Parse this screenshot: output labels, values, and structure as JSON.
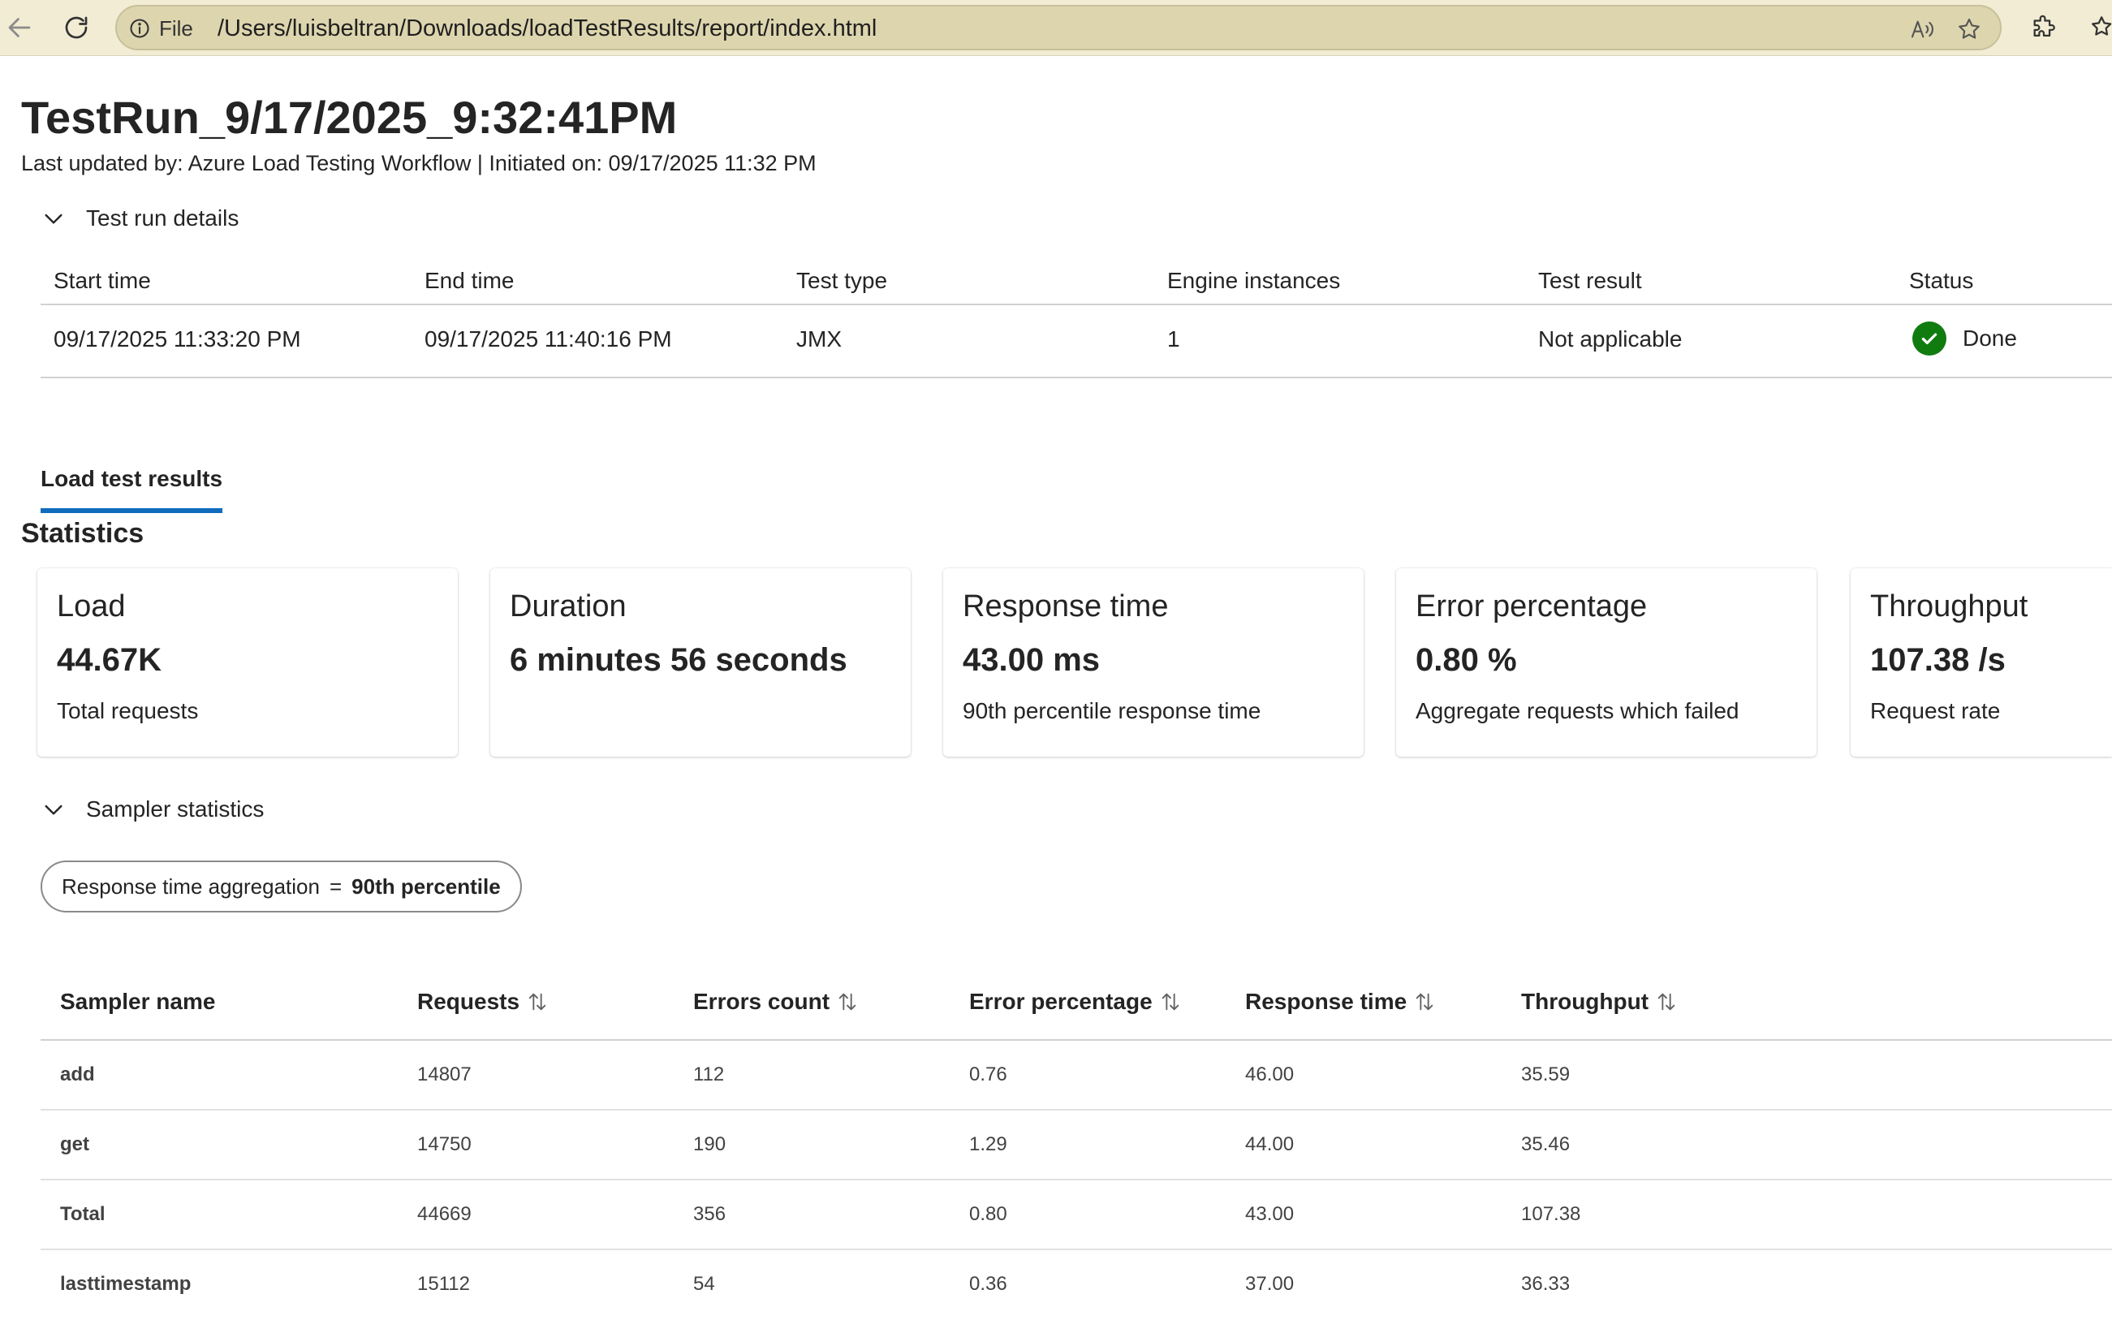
{
  "browser": {
    "file_label": "File",
    "url": "/Users/luisbeltran/Downloads/loadTestResults/report/index.html"
  },
  "page": {
    "title": "TestRun_9/17/2025_9:32:41PM",
    "subtitle": "Last updated by: Azure Load Testing Workflow | Initiated on: 09/17/2025 11:32 PM"
  },
  "details": {
    "section_label": "Test run details",
    "headers": [
      "Start time",
      "End time",
      "Test type",
      "Engine instances",
      "Test result",
      "Status"
    ],
    "row": [
      "09/17/2025 11:33:20 PM",
      "09/17/2025 11:40:16 PM",
      "JMX",
      "1",
      "Not applicable",
      "Done"
    ],
    "status_color": "#107c10"
  },
  "tabs": {
    "active": "Load test results",
    "accent": "#0f6cbd"
  },
  "statistics": {
    "heading": "Statistics",
    "cards": [
      {
        "title": "Load",
        "value": "44.67K",
        "desc": "Total requests"
      },
      {
        "title": "Duration",
        "value": "6 minutes 56 seconds",
        "desc": ""
      },
      {
        "title": "Response time",
        "value": "43.00 ms",
        "desc": "90th percentile response time"
      },
      {
        "title": "Error percentage",
        "value": "0.80 %",
        "desc": "Aggregate requests which failed"
      },
      {
        "title": "Throughput",
        "value": "107.38 /s",
        "desc": "Request rate"
      }
    ]
  },
  "sampler": {
    "section_label": "Sampler statistics",
    "filter_label": "Response time aggregation",
    "filter_eq": "=",
    "filter_value": "90th percentile",
    "headers": [
      "Sampler name",
      "Requests",
      "Errors count",
      "Error percentage",
      "Response time",
      "Throughput"
    ],
    "rows": [
      [
        "add",
        "14807",
        "112",
        "0.76",
        "46.00",
        "35.59"
      ],
      [
        "get",
        "14750",
        "190",
        "1.29",
        "44.00",
        "35.46"
      ],
      [
        "Total",
        "44669",
        "356",
        "0.80",
        "43.00",
        "107.38"
      ],
      [
        "lasttimestamp",
        "15112",
        "54",
        "0.36",
        "37.00",
        "36.33"
      ]
    ]
  }
}
